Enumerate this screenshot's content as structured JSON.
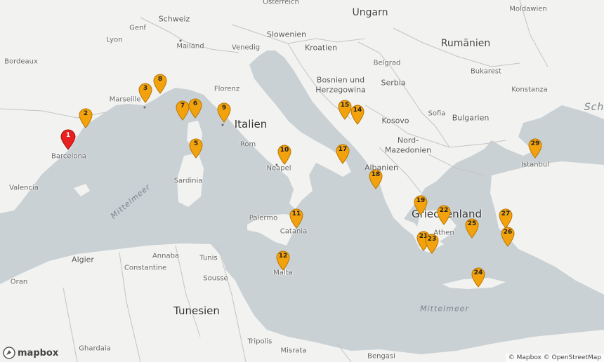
{
  "colors": {
    "water": "#c9d1d5",
    "land": "#f2f2f0",
    "border": "#c4c4c4",
    "marker": "#f2a20c",
    "marker_active": "#e8201f"
  },
  "labels": {
    "oesterreich": "Österreich",
    "ungarn": "Ungarn",
    "moldawien": "Moldawien",
    "schweiz": "Schweiz",
    "genf": "Genf",
    "lyon": "Lyon",
    "mailand": "Mailand",
    "venedig": "Venedig",
    "slowenien": "Slowenien",
    "kroatien": "Kroatien",
    "rumaenien": "Rumänien",
    "bordeaux": "Bordeaux",
    "belgrad": "Belgrad",
    "bukarest": "Bukarest",
    "bosnien": "Bosnien und",
    "herzegowina": "Herzegowina",
    "serbia": "Serbia",
    "marseille": "Marseille",
    "florenz": "Florenz",
    "konstanza": "Konstanza",
    "sch": "Sch",
    "sofia": "Sofia",
    "bulgarien": "Bulgarien",
    "italien": "Italien",
    "kosovo": "Kosovo",
    "nord": "Nord-",
    "mazedonien": "Mazedonien",
    "rom": "Rom",
    "barcelona": "Barcelona",
    "istanbul": "Istanbul",
    "albanien": "Albanien",
    "neapel": "Neapel",
    "valencia": "Valencia",
    "sardinia": "Sardinia",
    "mittelmeer_w": "Mittelmeer",
    "griechenland": "Griechenland",
    "athen": "Athen",
    "palermo": "Palermo",
    "catania": "Catania",
    "algier": "Algier",
    "annaba": "Annaba",
    "tunis": "Tunis",
    "constantine": "Constantine",
    "malta": "Malta",
    "oran": "Oran",
    "sousse": "Sousse",
    "tunesien": "Tunesien",
    "mittelmeer_e": "Mittelmeer",
    "tripolis": "Tripolis",
    "ghardaia": "Ghardaia",
    "misrata": "Misrata",
    "bengasi": "Bengasi"
  },
  "markers": {
    "m1": "1",
    "m2": "2",
    "m3": "3",
    "m5": "5",
    "m6": "6",
    "m7": "7",
    "m8": "8",
    "m9": "9",
    "m10": "10",
    "m11": "11",
    "m12": "12",
    "m14": "14",
    "m15": "15",
    "m17": "17",
    "m18": "18",
    "m19": "19",
    "m21": "21",
    "m22": "22",
    "m23": "23",
    "m24": "24",
    "m25": "25",
    "m26": "26",
    "m27": "27",
    "m29": "29"
  },
  "branding": {
    "logo": "mapbox",
    "attribution": "© Mapbox © OpenStreetMap"
  }
}
